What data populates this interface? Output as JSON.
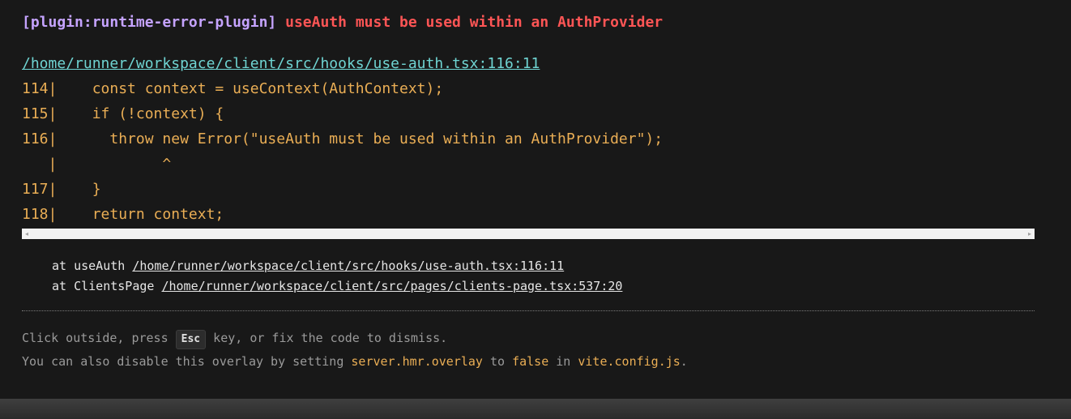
{
  "error": {
    "plugin": "[plugin:runtime-error-plugin]",
    "message": "useAuth must be used within an AuthProvider",
    "file": "/home/runner/workspace/client/src/hooks/use-auth.tsx:116:11"
  },
  "frame": [
    "114|    const context = useContext(AuthContext);",
    "115|    if (!context) {",
    "116|      throw new Error(\"useAuth must be used within an AuthProvider\");",
    "   |            ^",
    "117|    }",
    "118|    return context;"
  ],
  "stack": [
    {
      "prefix": "at useAuth ",
      "link": "/home/runner/workspace/client/src/hooks/use-auth.tsx:116:11"
    },
    {
      "prefix": "at ClientsPage ",
      "link": "/home/runner/workspace/client/src/pages/clients-page.tsx:537:20"
    }
  ],
  "tip": {
    "line1_before": "Click outside, press ",
    "key": "Esc",
    "line1_after": " key, or fix the code to dismiss.",
    "line2_a": "You can also disable this overlay by setting ",
    "line2_code1": "server.hmr.overlay",
    "line2_b": " to ",
    "line2_code2": "false",
    "line2_c": " in ",
    "line2_code3": "vite.config.js",
    "line2_d": "."
  },
  "icons": {
    "scroll_left": "◂",
    "scroll_right": "▸"
  }
}
